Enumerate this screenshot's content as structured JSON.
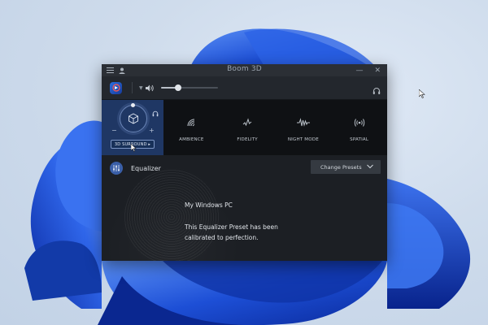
{
  "app": {
    "title": "Boom 3D"
  },
  "titlebar": {
    "minimize_glyph": "—",
    "close_glyph": "✕"
  },
  "volume": {
    "level": 0.3
  },
  "effects": {
    "main": {
      "label": "3D SURROUND ▸"
    },
    "items": [
      {
        "label": "AMBIENCE",
        "icon": "ambience-icon"
      },
      {
        "label": "FIDELITY",
        "icon": "fidelity-icon"
      },
      {
        "label": "NIGHT MODE",
        "icon": "night-mode-icon"
      },
      {
        "label": "SPATIAL",
        "icon": "spatial-icon"
      }
    ]
  },
  "equalizer": {
    "title": "Equalizer",
    "preset_button": "Change Presets",
    "device": "My Windows PC",
    "description_line1": "This Equalizer Preset has been",
    "description_line2": "calibrated to perfection."
  },
  "colors": {
    "window_bg": "#1b1e23",
    "accent": "#2a6fe0",
    "effect_active": "#1f3764"
  }
}
